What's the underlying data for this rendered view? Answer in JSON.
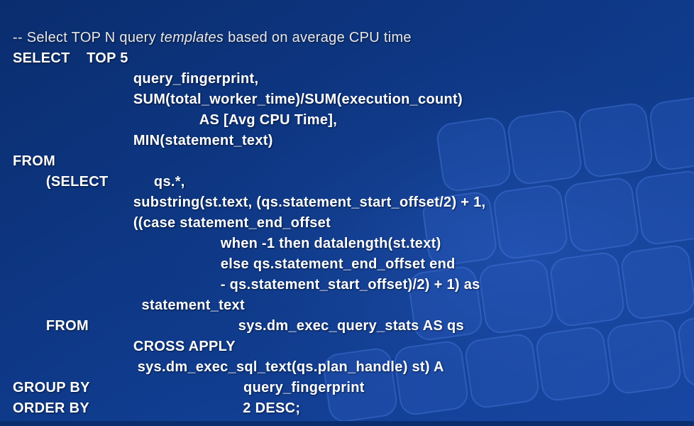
{
  "code": {
    "comment_prefix": "-- Select TOP N query ",
    "comment_italic": "templates",
    "comment_suffix": " based on average CPU time",
    "line01": "SELECT    TOP 5",
    "line02": "                             query_fingerprint,",
    "line03": "                             SUM(total_worker_time)/SUM(execution_count)",
    "line04": "                                             AS [Avg CPU Time],",
    "line05": "                             MIN(statement_text)",
    "line06": "FROM",
    "line07": "        (SELECT           qs.*,",
    "line08": "                             substring(st.text, (qs.statement_start_offset/2) + 1,",
    "line09": "                             ((case statement_end_offset",
    "line10": "                                                  when -1 then datalength(st.text)",
    "line11": "                                                  else qs.statement_end_offset end",
    "line12": "                                                  - qs.statement_start_offset)/2) + 1) as",
    "line13": "                               statement_text",
    "line14": "        FROM                                    sys.dm_exec_query_stats AS qs",
    "line15": "                             CROSS APPLY",
    "line16": "                              sys.dm_exec_sql_text(qs.plan_handle) st) A",
    "line17": "GROUP BY                                     query_fingerprint",
    "line18": "ORDER BY                                     2 DESC;"
  }
}
